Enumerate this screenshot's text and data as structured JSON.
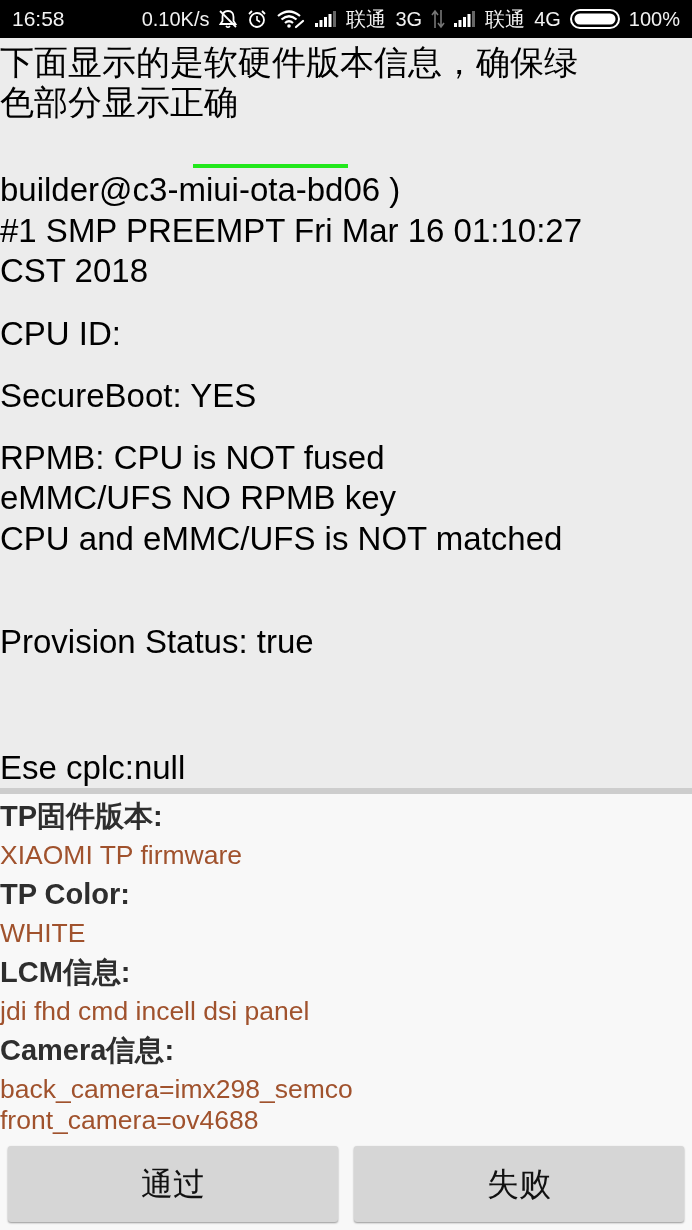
{
  "status_bar": {
    "time": "16:58",
    "net_speed": "0.10K/s",
    "sims": [
      {
        "carrier": "联通",
        "network": "3G"
      },
      {
        "carrier": "联通",
        "network": "4G"
      }
    ],
    "battery": "100%"
  },
  "header": {
    "text": "下面显示的是软硬件版本信息，确保绿色部分显示正确"
  },
  "info_blocks": [
    {
      "lines": [
        "builder@c3-miui-ota-bd06 )",
        "#1 SMP PREEMPT Fri Mar 16 01:10:27",
        "CST 2018"
      ]
    },
    {
      "lines": [
        "CPU ID:"
      ]
    },
    {
      "lines": [
        "SecureBoot: YES"
      ]
    },
    {
      "lines": [
        "RPMB: CPU is NOT fused",
        "eMMC/UFS NO RPMB key",
        "CPU and eMMC/UFS is NOT matched"
      ]
    },
    {
      "lines": [
        "Provision Status: true"
      ]
    },
    {
      "lines": [
        "Ese cplc:null"
      ]
    }
  ],
  "details": [
    {
      "label": "TP固件版本:",
      "value": "XIAOMI TP firmware"
    },
    {
      "label": "TP Color:",
      "value": "WHITE"
    },
    {
      "label": "LCM信息:",
      "value": "jdi fhd cmd incell dsi panel"
    },
    {
      "label": "Camera信息:",
      "value": "back_camera=imx298_semco\nfront_camera=ov4688"
    }
  ],
  "buttons": [
    {
      "label": "通过"
    },
    {
      "label": "失败"
    }
  ]
}
